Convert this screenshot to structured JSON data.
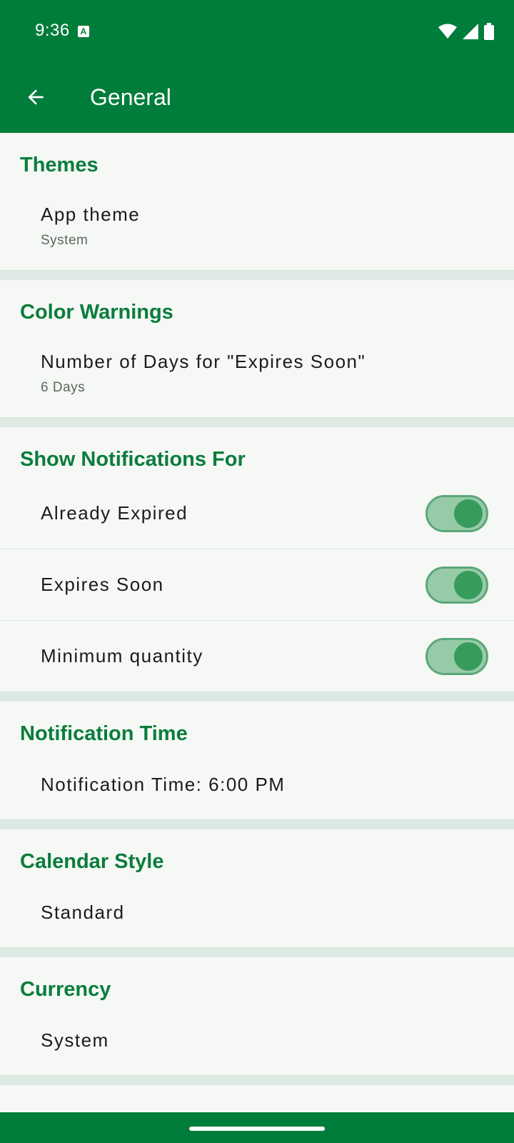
{
  "status_bar": {
    "time": "9:36",
    "notification_icon_letter": "A",
    "icons": [
      "wifi-icon",
      "signal-icon",
      "battery-icon"
    ]
  },
  "app_bar": {
    "title": "General",
    "back_icon": "arrow-back-icon"
  },
  "colors": {
    "primary": "#007d3a",
    "accent_text": "#0a7d3b",
    "switch_track": "#97cba8",
    "switch_thumb": "#379b5c",
    "danger_text": "#b3261e"
  },
  "sections": {
    "themes": {
      "header": "Themes",
      "app_theme": {
        "title": "App theme",
        "summary": "System"
      }
    },
    "color_warnings": {
      "header": "Color Warnings",
      "days": {
        "title": "Number of Days for \"Expires Soon\"",
        "summary": "6 Days"
      }
    },
    "notifications": {
      "header": "Show Notifications For",
      "items": [
        {
          "title": "Already Expired",
          "enabled": true
        },
        {
          "title": "Expires Soon",
          "enabled": true
        },
        {
          "title": "Minimum quantity",
          "enabled": true
        }
      ]
    },
    "notification_time": {
      "header": "Notification Time",
      "item": {
        "title": "Notification Time: 6:00 PM"
      }
    },
    "calendar_style": {
      "header": "Calendar Style",
      "item": {
        "title": "Standard"
      }
    },
    "currency": {
      "header": "Currency",
      "item": {
        "title": "System"
      }
    }
  }
}
